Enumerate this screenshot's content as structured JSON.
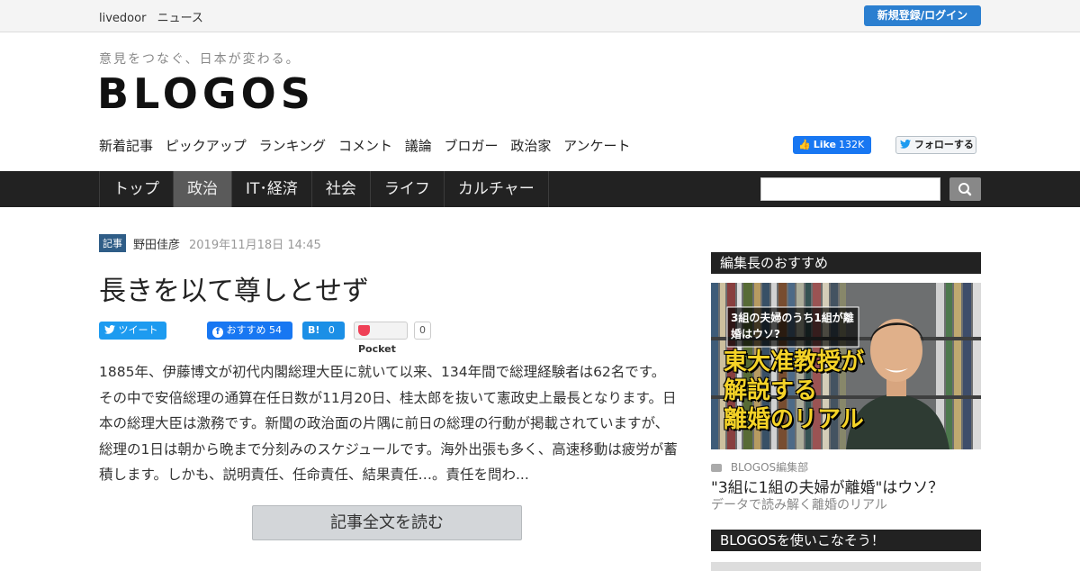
{
  "topbar": {
    "brand": "livedoor",
    "section": "ニュース",
    "login_label": "新規登録/ログイン"
  },
  "header": {
    "tagline": "意見をつなぐ、日本が変わる。",
    "logo": "BLOGOS",
    "subnav": [
      "新着記事",
      "ピックアップ",
      "ランキング",
      "コメント",
      "議論",
      "ブロガー",
      "政治家",
      "アンケート"
    ],
    "fb_like": {
      "label": "Like",
      "count": "132K"
    },
    "twitter_follow": "フォローする"
  },
  "mainnav": {
    "items": [
      "トップ",
      "政治",
      "IT･経済",
      "社会",
      "ライフ",
      "カルチャー"
    ],
    "active_index": 1,
    "search_placeholder": ""
  },
  "article": {
    "badge": "記事",
    "author": "野田佳彦",
    "date": "2019年11月18日 14:45",
    "title": "長きを以て尊しとせず",
    "share": {
      "tweet": "ツイート",
      "facebook": "おすすめ",
      "facebook_count": "54",
      "hatena": "B!",
      "hatena_count": "0",
      "pocket": "Pocket",
      "pocket_count": "0"
    },
    "body": "1885年、伊藤博文が初代内閣総理大臣に就いて以来、134年間で総理経験者は62名です。その中で安倍総理の通算在任日数が11月20日、桂太郎を抜いて憲政史上最長となります。日本の総理大臣は激務です。新聞の政治面の片隅に前日の総理の行動が掲載されていますが、総理の1日は朝から晩まで分刻みのスケジュールです。海外出張も多く、高速移動は疲労が蓄積します。しかも、説明責任、任命責任、結果責任…。責任を問わ...",
    "read_more": "記事全文を読む"
  },
  "sidebar": {
    "section1_title": "編集長のおすすめ",
    "feature": {
      "image_caption_top": "3組の夫婦のうち1組が離婚はウソ?",
      "image_headline": [
        "東大准教授が",
        "解説する",
        "離婚のリアル"
      ],
      "source": "BLOGOS編集部",
      "title": "\"3組に1組の夫婦が離婚\"はウソ？",
      "subtitle": "データで読み解く離婚のリアル"
    },
    "section2_title": "BLOGOSを使いこなそう！"
  },
  "colors": {
    "nav_bg": "#222222",
    "login_blue": "#2b7fd0",
    "badge_blue": "#2f5d87",
    "headline_yellow": "#f5d327"
  }
}
